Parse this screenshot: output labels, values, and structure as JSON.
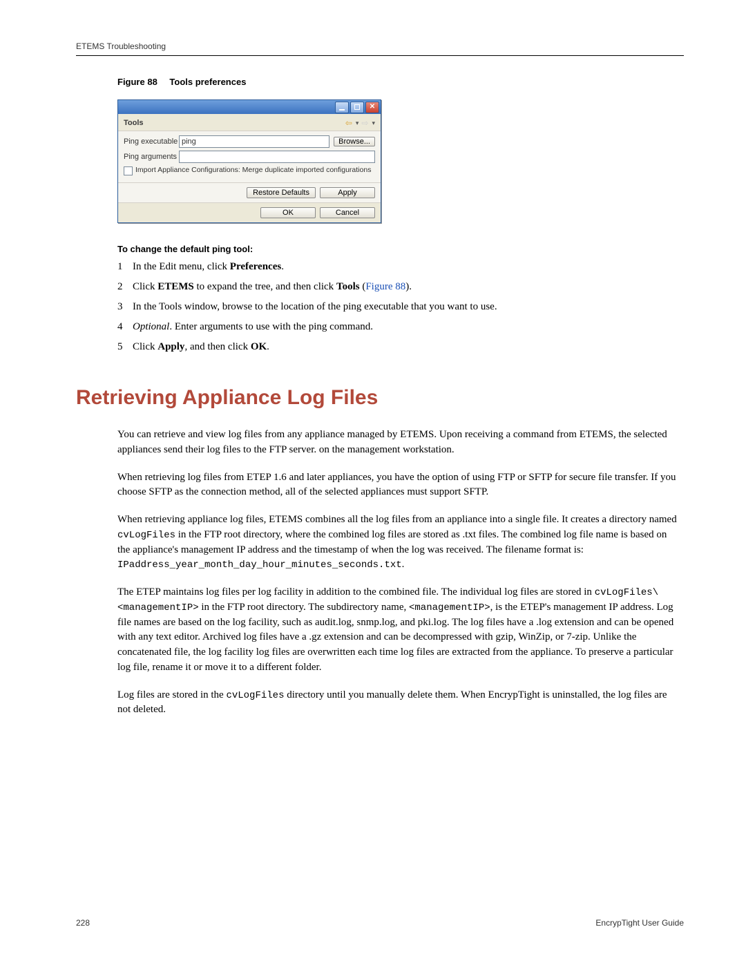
{
  "header": {
    "section": "ETEMS Troubleshooting"
  },
  "figure": {
    "num_label": "Figure 88",
    "title": "Tools preferences"
  },
  "dialog": {
    "title": "Tools",
    "ping_exec_label": "Ping executable",
    "ping_exec_value": "ping",
    "browse_label": "Browse...",
    "ping_args_label": "Ping arguments",
    "ping_args_value": "",
    "checkbox_label": "Import Appliance Configurations: Merge duplicate imported configurations",
    "restore_defaults": "Restore Defaults",
    "apply": "Apply",
    "ok": "OK",
    "cancel": "Cancel"
  },
  "instructions": {
    "heading": "To change the default ping tool:",
    "steps": [
      {
        "n": "1",
        "pre": "In the Edit menu, click ",
        "b1": "Preferences",
        "post": "."
      },
      {
        "n": "2",
        "pre": "Click ",
        "b1": "ETEMS",
        "mid": " to expand the tree, and then click ",
        "b2": "Tools",
        "link_text": "Figure 88",
        "post_after_link": ").",
        "open_paren": " ("
      },
      {
        "n": "3",
        "full": "In the Tools window, browse to the location of the ping executable that you want to use."
      },
      {
        "n": "4",
        "ital": "Optional",
        "post_ital": ". Enter arguments to use with the ping command."
      },
      {
        "n": "5",
        "pre": "Click ",
        "b1": "Apply",
        "mid": ", and then click ",
        "b2": "OK",
        "post": "."
      }
    ]
  },
  "section": {
    "title": "Retrieving Appliance Log Files",
    "p1": "You can retrieve and view log files from any appliance managed by ETEMS. Upon receiving a command from ETEMS, the selected appliances send their log files to the FTP server. on the management workstation.",
    "p2": "When retrieving log files from ETEP 1.6 and later appliances, you have the option of using FTP or SFTP for secure file transfer. If you choose SFTP as the connection method, all of the selected appliances must support SFTP.",
    "p3a": "When retrieving appliance log files, ETEMS combines all the log files from an appliance into a single file. It creates a directory named ",
    "p3_code1": "cvLogFiles",
    "p3b": " in the FTP root directory, where the combined log files are stored as .txt files. The combined log file name is based on the appliance's management IP address and the timestamp of when the log was received. The filename format is: ",
    "p3_code2": "IPaddress_year_month_day_hour_minutes_seconds.txt",
    "p3c": ".",
    "p4a": "The ETEP maintains log files per log facility in addition to the combined file. The individual log files are stored in ",
    "p4_code1": "cvLogFiles\\<managementIP>",
    "p4b": " in the FTP root directory. The subdirectory name, ",
    "p4_code2": "<managementIP>",
    "p4c": ", is the ETEP's management IP address. Log file names are based on the log facility, such as audit.log, snmp.log, and pki.log. The log files have a .log extension and can be opened with any text editor. Archived log files have a .gz extension and can be decompressed with gzip, WinZip, or 7-zip. Unlike the concatenated file, the log facility log files are overwritten each time log files are extracted from the appliance. To preserve a particular log file, rename it or move it to a different folder.",
    "p5a": "Log files are stored in the ",
    "p5_code1": "cvLogFiles",
    "p5b": " directory until you manually delete them. When EncrypTight is uninstalled, the log files are not deleted."
  },
  "footer": {
    "page": "228",
    "doc": "EncrypTight User Guide"
  }
}
